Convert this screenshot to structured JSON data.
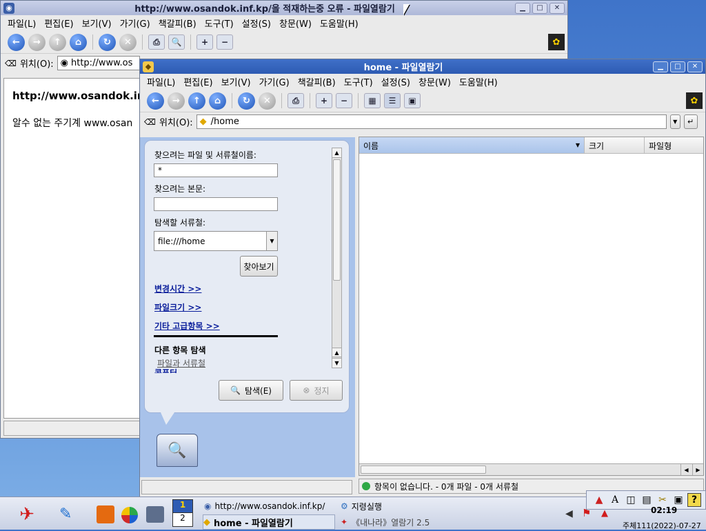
{
  "browser_window": {
    "title": "http://www.osandok.inf.kp/을 적재하는중 오류 - 파일열람기",
    "menu": [
      "파일(L)",
      "편집(E)",
      "보기(V)",
      "가기(G)",
      "책갈피(B)",
      "도구(T)",
      "설정(S)",
      "창문(W)",
      "도움말(H)"
    ],
    "location_label": "위치(O):",
    "location_value": "http://www.os",
    "page_heading": "http://www.osandok.ir",
    "page_text": "알수 없는 주기계 www.osan"
  },
  "fm_window": {
    "title": "home - 파일열람기",
    "menu": [
      "파일(L)",
      "편집(E)",
      "보기(V)",
      "가기(G)",
      "책갈피(B)",
      "도구(T)",
      "설정(S)",
      "창문(W)",
      "도움말(H)"
    ],
    "location_label": "위치(O):",
    "location_value": "/home",
    "search": {
      "name_label": "찾으려는 파일 및 서류철이름:",
      "name_value": "*",
      "content_label": "찾으려는 본문:",
      "content_value": "",
      "folder_label": "탐색할 서류철:",
      "folder_value": "file:///home",
      "browse_button": "찾아보기",
      "link_modified": "변경시간 >>",
      "link_size": "파일크기 >>",
      "link_advanced": "기타 고급항목 >>",
      "other_search_heading": "다른 항목 탐색",
      "other_item1": "파일과 서류철",
      "other_item2": "콤퓨터",
      "search_button": "탐색(E)",
      "stop_button": "정지"
    },
    "columns": [
      "이름",
      "크기",
      "파일형"
    ],
    "status": "항목이 없습니다. - 0개 파일 - 0개 서류철"
  },
  "taskbar": {
    "desktop_pager": [
      "1",
      "2"
    ],
    "tasks": [
      {
        "label": "http://www.osandok.inf.kp/"
      },
      {
        "label": "지령실행"
      },
      {
        "label": "home - 파일열람기"
      },
      {
        "label": "《내나라》열람기 2.5"
      }
    ],
    "clock": "02:19",
    "date": "주체111(2022)-07-27"
  },
  "colors": {
    "title_active": "#2d5bb3",
    "sidebar_bg": "#a8c2ea",
    "link": "#0a1e9b"
  }
}
